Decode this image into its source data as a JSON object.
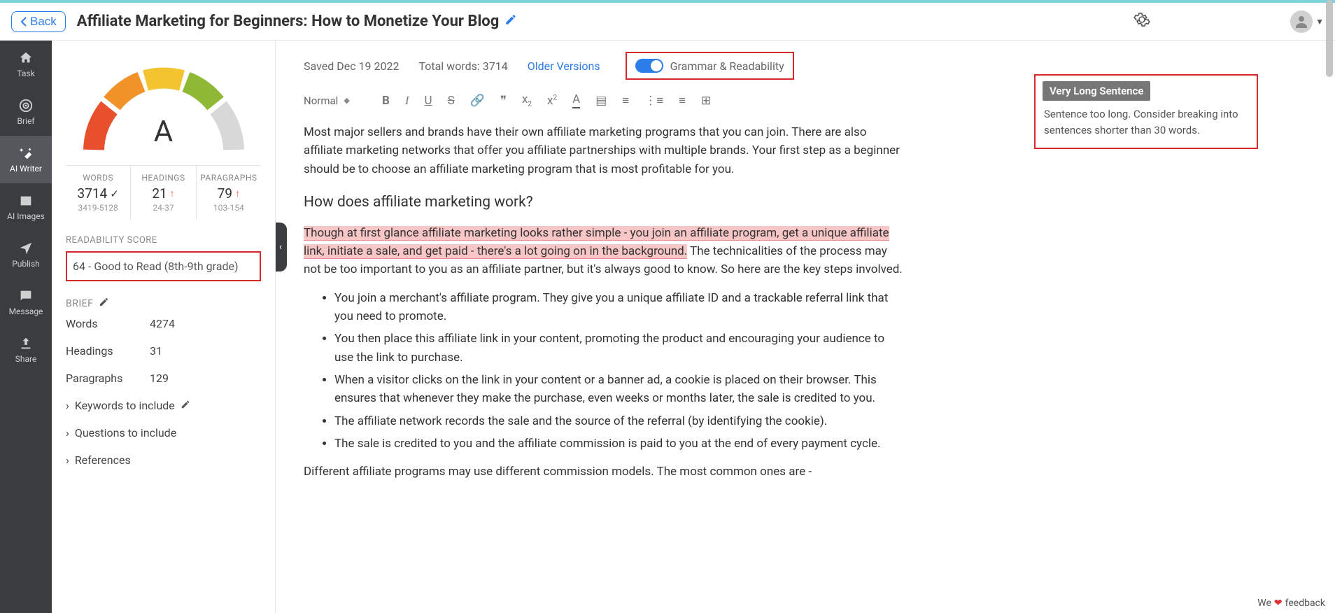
{
  "header": {
    "back_label": "Back",
    "title": "Affiliate Marketing for Beginners: How to Monetize Your Blog"
  },
  "sidebar": {
    "items": [
      {
        "label": "Task"
      },
      {
        "label": "Brief"
      },
      {
        "label": "AI Writer"
      },
      {
        "label": "AI Images"
      },
      {
        "label": "Publish"
      },
      {
        "label": "Message"
      },
      {
        "label": "Share"
      }
    ]
  },
  "panel": {
    "grade": "A",
    "stats": {
      "words": {
        "label": "WORDS",
        "value": "3714",
        "range": "3419-5128",
        "status": "ok"
      },
      "headings": {
        "label": "HEADINGS",
        "value": "21",
        "range": "24-37",
        "status": "up"
      },
      "paragraphs": {
        "label": "PARAGRAPHS",
        "value": "79",
        "range": "103-154",
        "status": "up"
      }
    },
    "readability_label": "READABILITY SCORE",
    "readability_value": "64 - Good to Read (8th-9th grade)",
    "brief_label": "BRIEF",
    "brief": {
      "words": {
        "label": "Words",
        "value": "4274"
      },
      "headings": {
        "label": "Headings",
        "value": "31"
      },
      "paragraphs": {
        "label": "Paragraphs",
        "value": "129"
      }
    },
    "expand": {
      "keywords": "Keywords to include",
      "questions": "Questions to include",
      "references": "References"
    }
  },
  "doc": {
    "saved": "Saved Dec 19 2022",
    "total_words": "Total words: 3714",
    "older_versions": "Older Versions",
    "grammar_label": "Grammar & Readability",
    "format": "Normal"
  },
  "content": {
    "p1": "Most major sellers and brands have their own affiliate marketing programs that you can join. There are also affiliate marketing networks that offer you affiliate partnerships with multiple brands. Your first step as a beginner should be to choose an affiliate marketing program that is most profitable for you.",
    "h1": "How does affiliate marketing work?",
    "p2a": "Though at first glance affiliate marketing looks rather simple - you join an affiliate program, get a unique affiliate link, initiate a sale, and get paid - there's a lot going on in the background.",
    "p2b": " The technicalities of the process may not be too important to you as an affiliate partner, but it's always good to know. So here are the key steps involved.",
    "bullets": [
      "You join a merchant's affiliate program. They give you a unique affiliate ID and a trackable referral link that you need to promote.",
      "You then place this affiliate link in your content, promoting the product and encouraging your audience to use the link to purchase.",
      "When a visitor clicks on the link in your content or a banner ad, a cookie is placed on their browser. This ensures that whenever they make the purchase, even weeks or months later, the sale is credited to you.",
      "The affiliate network records the sale and the source of the referral (by identifying the cookie).",
      "The sale is credited to you and the affiliate commission is paid to you at the end of every payment cycle."
    ],
    "p3": "Different affiliate programs may use different commission models. The most common ones are -"
  },
  "tooltip": {
    "title": "Very Long Sentence",
    "body": "Sentence too long. Consider breaking into sentences shorter than 30 words."
  },
  "feedback": {
    "pre": "We ",
    "post": " feedback"
  }
}
